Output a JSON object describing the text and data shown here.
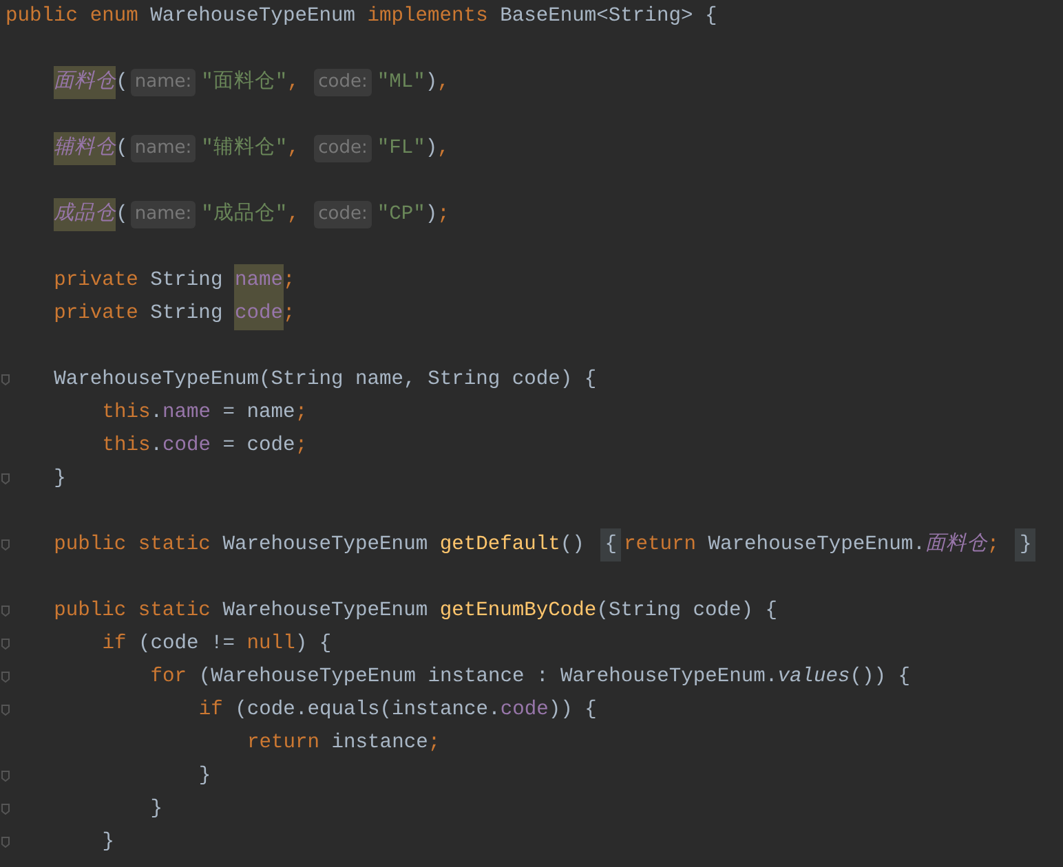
{
  "lines": [
    {
      "kind": "code",
      "fold": false,
      "tokens": [
        {
          "text": "public ",
          "kind": "keyword"
        },
        {
          "text": "enum ",
          "kind": "keyword"
        },
        {
          "text": "WarehouseTypeEnum ",
          "kind": "plain"
        },
        {
          "text": "implements ",
          "kind": "keyword"
        },
        {
          "text": "BaseEnum<String> {",
          "kind": "plain"
        }
      ],
      "children": [
        {
          "kind": "blank"
        },
        {
          "kind": "code",
          "fold": false,
          "tokens": [
            {
              "text": "面料仓",
              "kind": "enum-marked"
            },
            {
              "text": "(",
              "kind": "plain"
            },
            {
              "text": "name:",
              "kind": "hint"
            },
            {
              "text": "\"面料仓\"",
              "kind": "string"
            },
            {
              "text": ", ",
              "kind": "keyword"
            },
            {
              "text": "code:",
              "kind": "hint"
            },
            {
              "text": "\"ML\"",
              "kind": "string"
            },
            {
              "text": ")",
              "kind": "plain"
            },
            {
              "text": ",",
              "kind": "keyword"
            }
          ]
        },
        {
          "kind": "blank"
        },
        {
          "kind": "code",
          "fold": false,
          "tokens": [
            {
              "text": "辅料仓",
              "kind": "enum-marked"
            },
            {
              "text": "(",
              "kind": "plain"
            },
            {
              "text": "name:",
              "kind": "hint"
            },
            {
              "text": "\"辅料仓\"",
              "kind": "string"
            },
            {
              "text": ", ",
              "kind": "keyword"
            },
            {
              "text": "code:",
              "kind": "hint"
            },
            {
              "text": "\"FL\"",
              "kind": "string"
            },
            {
              "text": ")",
              "kind": "plain"
            },
            {
              "text": ",",
              "kind": "keyword"
            }
          ]
        },
        {
          "kind": "blank"
        },
        {
          "kind": "code",
          "fold": false,
          "tokens": [
            {
              "text": "成品仓",
              "kind": "enum-marked"
            },
            {
              "text": "(",
              "kind": "plain"
            },
            {
              "text": "name:",
              "kind": "hint"
            },
            {
              "text": "\"成品仓\"",
              "kind": "string"
            },
            {
              "text": ", ",
              "kind": "keyword"
            },
            {
              "text": "code:",
              "kind": "hint"
            },
            {
              "text": "\"CP\"",
              "kind": "string"
            },
            {
              "text": ")",
              "kind": "plain"
            },
            {
              "text": ";",
              "kind": "keyword"
            }
          ]
        },
        {
          "kind": "blank"
        },
        {
          "kind": "code",
          "fold": false,
          "tokens": [
            {
              "text": "private ",
              "kind": "keyword"
            },
            {
              "text": "String ",
              "kind": "plain"
            },
            {
              "text": "name",
              "kind": "field-marked"
            },
            {
              "text": ";",
              "kind": "keyword"
            }
          ]
        },
        {
          "kind": "code",
          "fold": false,
          "tokens": [
            {
              "text": "private ",
              "kind": "keyword"
            },
            {
              "text": "String ",
              "kind": "plain"
            },
            {
              "text": "code",
              "kind": "field-marked"
            },
            {
              "text": ";",
              "kind": "keyword"
            }
          ]
        },
        {
          "kind": "blank"
        },
        {
          "kind": "code",
          "fold": true,
          "tokens": [
            {
              "text": "WarehouseTypeEnum(String name, String code) {",
              "kind": "plain"
            }
          ],
          "children": [
            {
              "kind": "code",
              "fold": false,
              "tokens": [
                {
                  "text": "this",
                  "kind": "keyword"
                },
                {
                  "text": ".",
                  "kind": "plain"
                },
                {
                  "text": "name",
                  "kind": "field"
                },
                {
                  "text": " = name",
                  "kind": "plain"
                },
                {
                  "text": ";",
                  "kind": "keyword"
                }
              ]
            },
            {
              "kind": "code",
              "fold": false,
              "tokens": [
                {
                  "text": "this",
                  "kind": "keyword"
                },
                {
                  "text": ".",
                  "kind": "plain"
                },
                {
                  "text": "code",
                  "kind": "field"
                },
                {
                  "text": " = code",
                  "kind": "plain"
                },
                {
                  "text": ";",
                  "kind": "keyword"
                }
              ]
            }
          ]
        },
        {
          "kind": "code",
          "fold": true,
          "tokens": [
            {
              "text": "}",
              "kind": "plain"
            }
          ]
        },
        {
          "kind": "blank"
        },
        {
          "kind": "code",
          "fold": true,
          "tokens": [
            {
              "text": "public static ",
              "kind": "keyword"
            },
            {
              "text": "WarehouseTypeEnum ",
              "kind": "plain"
            },
            {
              "text": "getDefault",
              "kind": "method"
            },
            {
              "text": "() ",
              "kind": "plain"
            },
            {
              "text": "{",
              "kind": "brace-marked"
            },
            {
              "text": "return ",
              "kind": "keyword"
            },
            {
              "text": "WarehouseTypeEnum.",
              "kind": "plain"
            },
            {
              "text": "面料仓",
              "kind": "enum-static"
            },
            {
              "text": "; ",
              "kind": "keyword"
            },
            {
              "text": "}",
              "kind": "brace-marked"
            }
          ]
        },
        {
          "kind": "blank"
        },
        {
          "kind": "code",
          "fold": true,
          "tokens": [
            {
              "text": "public static ",
              "kind": "keyword"
            },
            {
              "text": "WarehouseTypeEnum ",
              "kind": "plain"
            },
            {
              "text": "getEnumByCode",
              "kind": "method"
            },
            {
              "text": "(String code) {",
              "kind": "plain"
            }
          ],
          "children": [
            {
              "kind": "code",
              "fold": true,
              "tokens": [
                {
                  "text": "if ",
                  "kind": "keyword"
                },
                {
                  "text": "(code != ",
                  "kind": "plain"
                },
                {
                  "text": "null",
                  "kind": "keyword"
                },
                {
                  "text": ") {",
                  "kind": "plain"
                }
              ],
              "children": [
                {
                  "kind": "code",
                  "fold": true,
                  "tokens": [
                    {
                      "text": "for ",
                      "kind": "keyword"
                    },
                    {
                      "text": "(WarehouseTypeEnum instance : WarehouseTypeEnum.",
                      "kind": "plain"
                    },
                    {
                      "text": "values",
                      "kind": "static-call"
                    },
                    {
                      "text": "()) {",
                      "kind": "plain"
                    }
                  ],
                  "children": [
                    {
                      "kind": "code",
                      "fold": true,
                      "tokens": [
                        {
                          "text": "if ",
                          "kind": "keyword"
                        },
                        {
                          "text": "(code.equals(instance.",
                          "kind": "plain"
                        },
                        {
                          "text": "code",
                          "kind": "field"
                        },
                        {
                          "text": ")) {",
                          "kind": "plain"
                        }
                      ],
                      "children": [
                        {
                          "kind": "code",
                          "fold": false,
                          "tokens": [
                            {
                              "text": "return ",
                              "kind": "keyword"
                            },
                            {
                              "text": "instance",
                              "kind": "plain"
                            },
                            {
                              "text": ";",
                              "kind": "keyword"
                            }
                          ]
                        }
                      ]
                    },
                    {
                      "kind": "code",
                      "fold": true,
                      "tokens": [
                        {
                          "text": "}",
                          "kind": "plain"
                        }
                      ]
                    }
                  ]
                },
                {
                  "kind": "code",
                  "fold": true,
                  "tokens": [
                    {
                      "text": "}",
                      "kind": "plain"
                    }
                  ]
                }
              ]
            },
            {
              "kind": "code",
              "fold": true,
              "tokens": [
                {
                  "text": "}",
                  "kind": "plain"
                }
              ]
            }
          ]
        }
      ]
    }
  ]
}
